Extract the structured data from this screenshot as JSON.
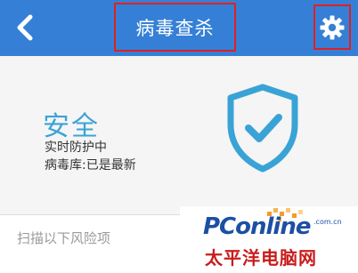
{
  "header": {
    "title": "病毒查杀",
    "back_icon": "chevron-left-icon",
    "settings_icon": "gear-icon"
  },
  "status": {
    "title": "安全",
    "line1": "实时防护中",
    "line2": "病毒库:已是最新",
    "shield_icon": "shield-check-icon"
  },
  "scan": {
    "label": "扫描以下风险项"
  },
  "watermark": {
    "brand": "PConline",
    "domain": ".com.cn",
    "chinese": "太平洋电脑网"
  },
  "colors": {
    "topbar": "#3580d6",
    "accent": "#3aa3d6",
    "highlight_box": "#e02020"
  }
}
